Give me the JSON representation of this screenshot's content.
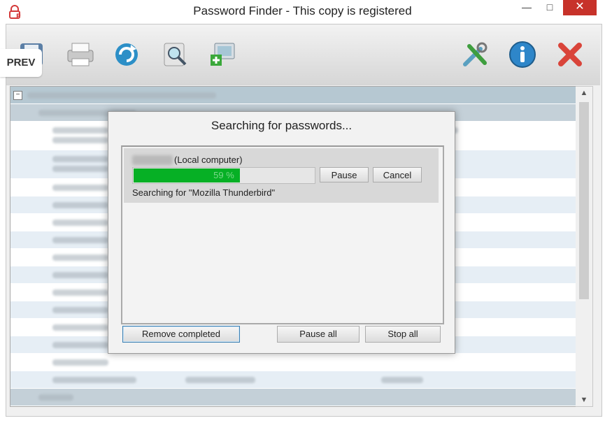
{
  "window": {
    "title": "Password Finder - This copy is registered",
    "minimize": "—",
    "maximize": "□",
    "close": "✕"
  },
  "toolbar": {
    "prev_label": "PREV",
    "icons": [
      "save-icon",
      "print-icon",
      "refresh-icon",
      "search-icon",
      "add-computer-icon",
      "settings-icon",
      "info-icon",
      "exit-icon"
    ]
  },
  "tree": {
    "expander": "−"
  },
  "dialog": {
    "title": "Searching for passwords...",
    "computer_suffix": "(Local computer)",
    "progress_percent": 59,
    "progress_text": "59 %",
    "pause_label": "Pause",
    "cancel_label": "Cancel",
    "status_text": "Searching for \"Mozilla Thunderbird\"",
    "remove_completed_label": "Remove completed",
    "pause_all_label": "Pause all",
    "stop_all_label": "Stop all"
  },
  "colors": {
    "progress": "#06b025",
    "close_button": "#c7322a",
    "group_row": "#b6c8d2"
  }
}
